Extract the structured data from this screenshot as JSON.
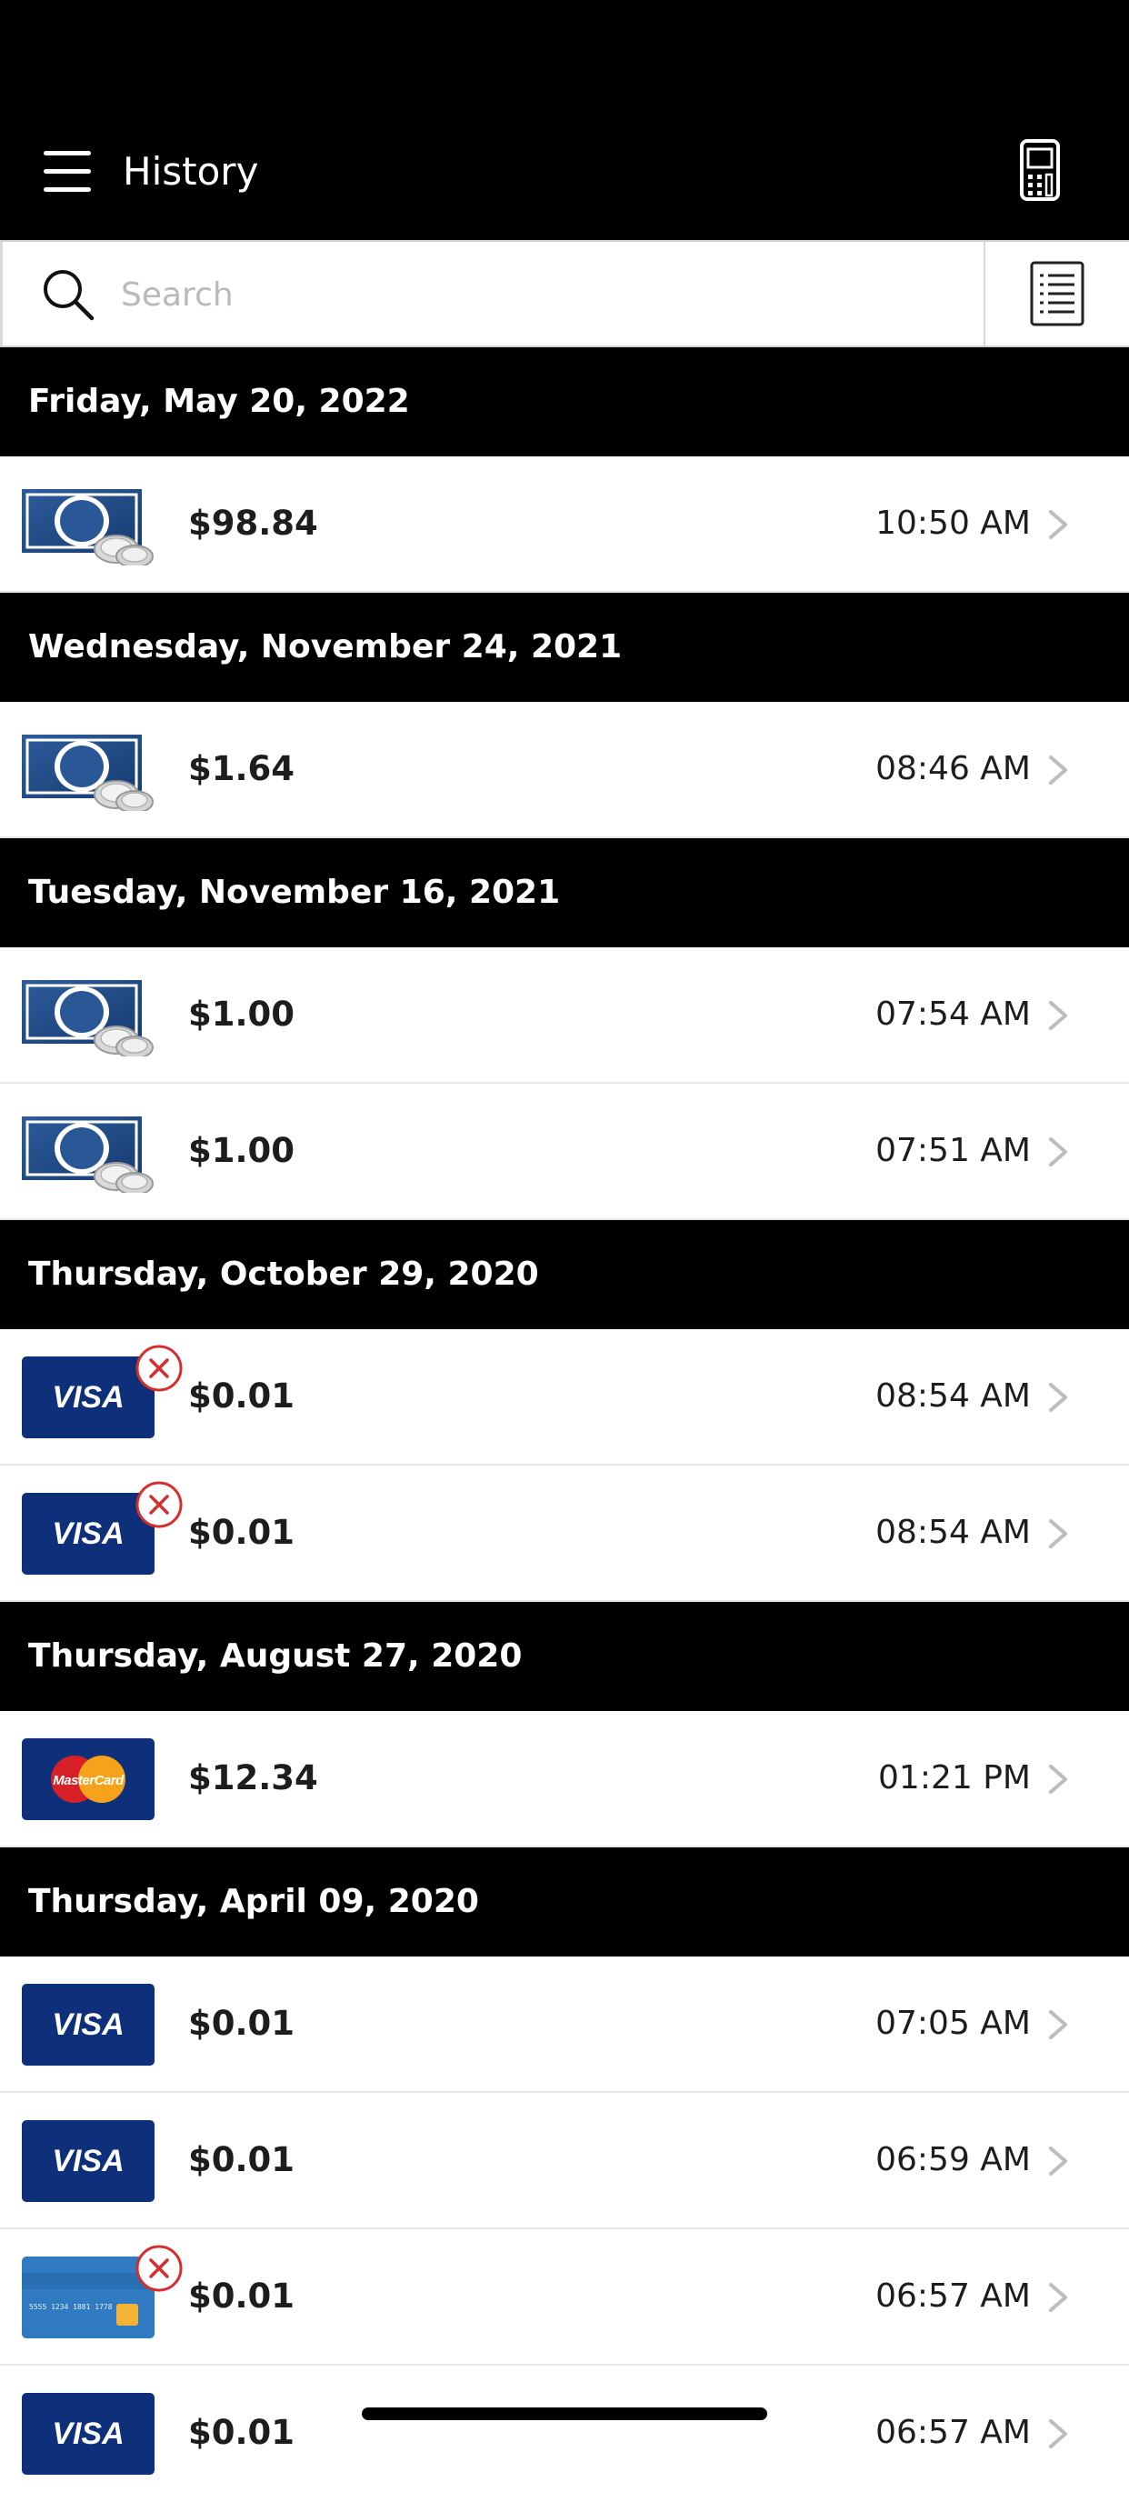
{
  "header": {
    "title": "History",
    "menu_icon": "hamburger-menu-icon",
    "terminal_icon": "card-terminal-icon"
  },
  "search": {
    "placeholder": "Search",
    "value": "",
    "icon": "search-icon",
    "list_icon": "list-icon"
  },
  "colors": {
    "header_bg": "#000000",
    "visa_blue": "#0e2f7a",
    "error_red": "#d62e2e",
    "chevron": "#bdbdbd"
  },
  "groups": [
    {
      "date": "Friday, May 20, 2022",
      "items": [
        {
          "type": "cash",
          "amount": "$98.84",
          "time": "10:50 AM",
          "error": false
        }
      ]
    },
    {
      "date": "Wednesday, November 24, 2021",
      "items": [
        {
          "type": "cash",
          "amount": "$1.64",
          "time": "08:46 AM",
          "error": false
        }
      ]
    },
    {
      "date": "Tuesday, November 16, 2021",
      "items": [
        {
          "type": "cash",
          "amount": "$1.00",
          "time": "07:54 AM",
          "error": false
        },
        {
          "type": "cash",
          "amount": "$1.00",
          "time": "07:51 AM",
          "error": false
        }
      ]
    },
    {
      "date": "Thursday, October 29, 2020",
      "items": [
        {
          "type": "visa",
          "amount": "$0.01",
          "time": "08:54 AM",
          "error": true
        },
        {
          "type": "visa",
          "amount": "$0.01",
          "time": "08:54 AM",
          "error": true
        }
      ]
    },
    {
      "date": "Thursday, August 27, 2020",
      "items": [
        {
          "type": "mastercard",
          "amount": "$12.34",
          "time": "01:21 PM",
          "error": false
        }
      ]
    },
    {
      "date": "Thursday, April 09, 2020",
      "items": [
        {
          "type": "visa",
          "amount": "$0.01",
          "time": "07:05 AM",
          "error": false
        },
        {
          "type": "visa",
          "amount": "$0.01",
          "time": "06:59 AM",
          "error": false
        },
        {
          "type": "generic",
          "amount": "$0.01",
          "time": "06:57 AM",
          "error": true
        },
        {
          "type": "visa",
          "amount": "$0.01",
          "time": "06:57 AM",
          "error": false
        }
      ]
    }
  ],
  "card_labels": {
    "visa": "VISA",
    "mastercard": "MasterCard",
    "generic_number": "5555 1234 1881 1778"
  }
}
